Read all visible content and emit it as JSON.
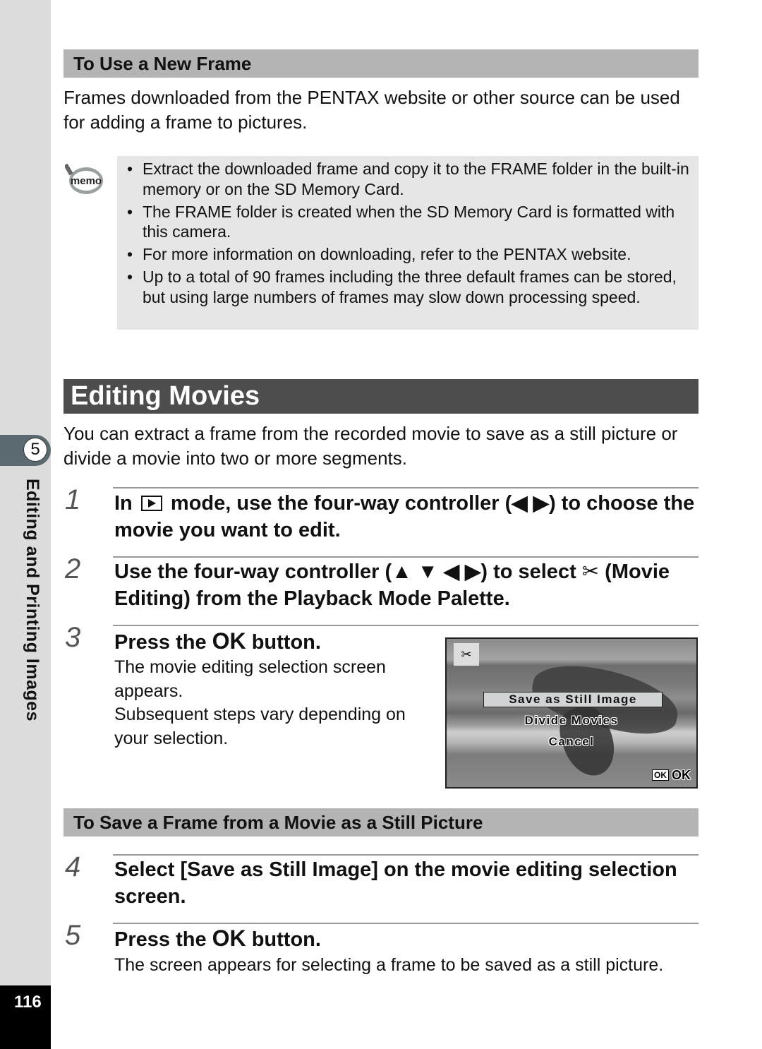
{
  "sidebar": {
    "chapter_number": "5",
    "chapter_title": "Editing and Printing Images",
    "page_number": "116"
  },
  "frame_section": {
    "heading": "To Use a New Frame",
    "intro": "Frames downloaded from the PENTAX website or other source can be used for adding a frame to pictures.",
    "memo_icon": "memo-icon",
    "memo_label": "memo",
    "memo_items": [
      "Extract the downloaded frame and copy it to the FRAME folder in the built-in memory or on the SD Memory Card.",
      "The FRAME folder is created when the SD Memory Card is formatted with this camera.",
      "For more information on downloading, refer to the PENTAX website.",
      "Up to a total of 90 frames including the three default frames can be stored, but using large numbers of frames may slow down processing speed."
    ]
  },
  "editing_section": {
    "title": "Editing Movies",
    "intro": "You can extract a frame from the recorded movie to save as a still picture or divide a movie into two or more segments.",
    "steps": [
      {
        "num": "1",
        "pre": "In",
        "icon": "playback-icon",
        "post": "mode, use the four-way controller (◀ ▶) to choose the movie you want to edit."
      },
      {
        "num": "2",
        "text": "Use the four-way controller (▲ ▼ ◀ ▶) to select",
        "icon": "movie-editing-icon",
        "post": "(Movie Editing) from the Playback Mode Palette."
      },
      {
        "num": "3",
        "pre": "Press the",
        "ok": "OK",
        "post": "button.",
        "desc": [
          "The movie editing selection screen",
          "appears.",
          "Subsequent steps vary depending on",
          "your selection."
        ]
      }
    ]
  },
  "camera_screen": {
    "mode_icon": "movie-editing-icon",
    "options": [
      "Save as Still Image",
      "Divide Movies",
      "Cancel"
    ],
    "selected_index": 0,
    "ok_button": "OK",
    "ok_label": "OK"
  },
  "save_section": {
    "heading": "To Save a Frame from a Movie as a Still Picture",
    "steps": [
      {
        "num": "4",
        "text": "Select [Save as Still Image] on the movie editing selection screen."
      },
      {
        "num": "5",
        "pre": "Press the",
        "ok": "OK",
        "post": "button.",
        "desc": "The screen appears for selecting a frame to be saved as a still picture."
      }
    ]
  }
}
